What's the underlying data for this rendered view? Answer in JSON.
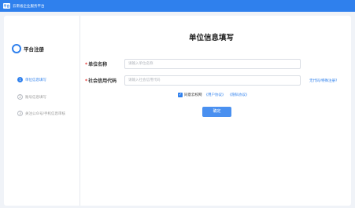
{
  "header": {
    "logo_text": "平台",
    "title": "云南省企业服务平台"
  },
  "page": {
    "title": "单位信息填写"
  },
  "sidebar": {
    "heading": "平台注册",
    "steps": [
      {
        "number": "1",
        "label": "单位信息填写"
      },
      {
        "number": "2",
        "label": "账号信息填写"
      },
      {
        "number": "3",
        "label": "关注公众号/手机信息审核"
      }
    ]
  },
  "form": {
    "required_mark": "*",
    "unit_name": {
      "label": "单位名称",
      "placeholder": "请输入单位名称"
    },
    "credit_code": {
      "label": "社会信用代码",
      "placeholder": "请输入社会信用代码"
    },
    "no_code_link": "无代码/特殊注册?",
    "agreement": {
      "text": "同意云校网",
      "user_agreement": "《用户协议》",
      "privacy_agreement": "《隐私协议》"
    },
    "confirm_label": "确定"
  },
  "colors": {
    "primary": "#2f80ed",
    "required": "#e53935",
    "background": "#f0f3f8"
  }
}
